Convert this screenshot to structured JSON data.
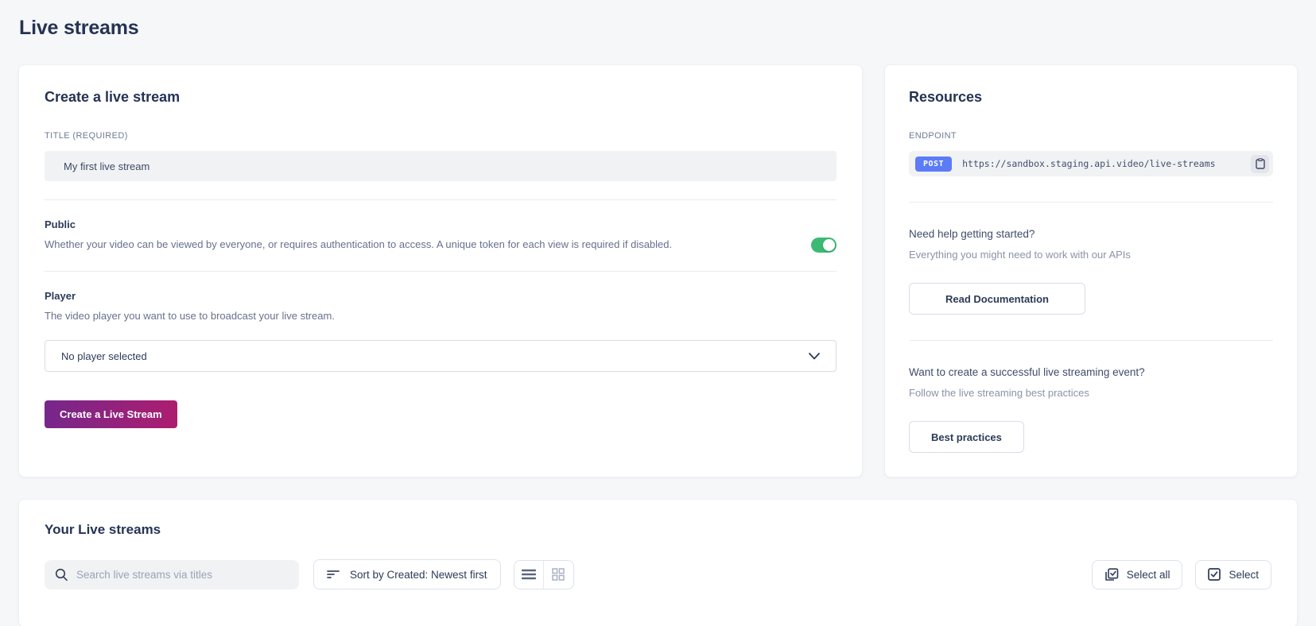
{
  "page": {
    "title": "Live streams"
  },
  "create_card": {
    "title": "Create a live stream",
    "title_field": {
      "label": "TITLE (REQUIRED)",
      "value": "My first live stream"
    },
    "public_setting": {
      "label": "Public",
      "description": "Whether your video can be viewed by everyone, or requires authentication to access. A unique token for each view is required if disabled.",
      "toggle_state": "on"
    },
    "player_setting": {
      "label": "Player",
      "description": "The video player you want to use to broadcast your live stream.",
      "select_value": "No player selected"
    },
    "submit_label": "Create a Live Stream"
  },
  "resources_card": {
    "title": "Resources",
    "endpoint": {
      "label": "ENDPOINT",
      "method": "POST",
      "url": "https://sandbox.staging.api.video/live-streams",
      "copy_icon": "clipboard-icon"
    },
    "docs": {
      "heading": "Need help getting started?",
      "subheading": "Everything you might need to work with our APIs",
      "button_label": "Read Documentation"
    },
    "best_practices": {
      "heading": "Want to create a successful live streaming event?",
      "subheading": "Follow the live streaming best practices",
      "button_label": "Best practices"
    }
  },
  "streams_card": {
    "title": "Your Live streams",
    "search": {
      "placeholder": "Search live streams via titles",
      "icon": "search-icon"
    },
    "sort": {
      "label": "Sort by Created: Newest first",
      "icon": "sort-descending-icon"
    },
    "view_modes": {
      "list_icon": "list-view-icon",
      "grid_icon": "grid-view-icon",
      "active": "list"
    },
    "select_all_label": "Select all",
    "select_label": "Select"
  },
  "colors": {
    "page_background": "#f6f7f9",
    "card_background": "#ffffff",
    "heading_text": "#253354",
    "muted_text": "#8b93a7",
    "toggle_on_green": "#3cba73",
    "post_badge_blue": "#5b7bf7",
    "submit_gradient_start": "#76278b",
    "submit_gradient_end": "#ad1d70"
  }
}
